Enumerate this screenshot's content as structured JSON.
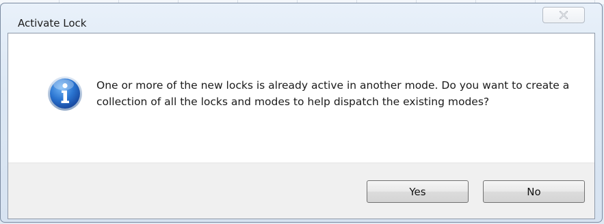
{
  "dialog": {
    "title": "Activate Lock",
    "message": "One or more of the new locks is already active in another mode. Do you want to create a collection of all the locks and modes to help dispatch the existing modes?",
    "icon": "info-icon",
    "close_icon": "close-icon",
    "buttons": {
      "yes_label": "Yes",
      "no_label": "No"
    }
  },
  "colors": {
    "frame": "#dbe7f4",
    "icon_blue": "#1f5fb4",
    "button_area": "#f0f0f0"
  }
}
